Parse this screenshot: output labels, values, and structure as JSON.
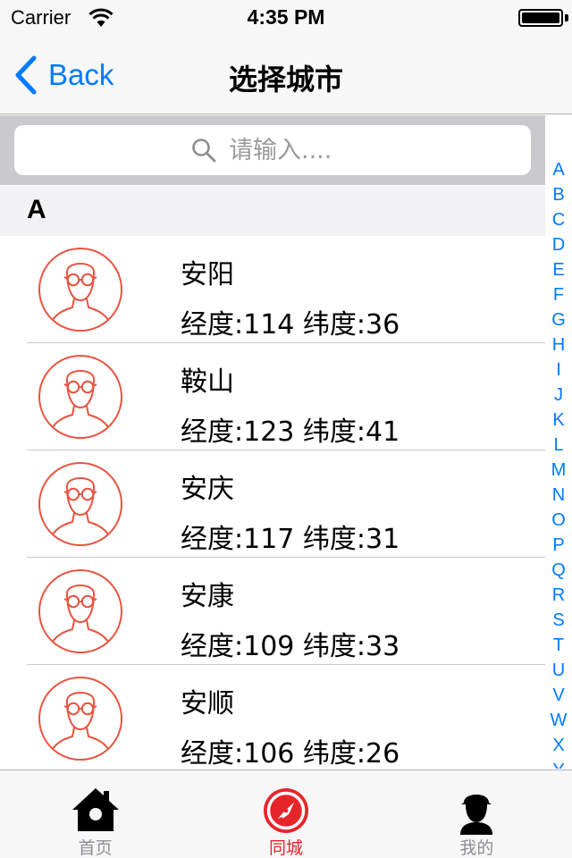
{
  "status_bar": {
    "carrier": "Carrier",
    "time": "4:35 PM"
  },
  "nav": {
    "back_label": "Back",
    "title": "选择城市"
  },
  "search": {
    "placeholder": "请输入...."
  },
  "section": {
    "letter": "A"
  },
  "cities": [
    {
      "name": "安阳",
      "coords": "经度:114 纬度:36"
    },
    {
      "name": "鞍山",
      "coords": "经度:123 纬度:41"
    },
    {
      "name": "安庆",
      "coords": "经度:117 纬度:31"
    },
    {
      "name": "安康",
      "coords": "经度:109 纬度:33"
    },
    {
      "name": "安顺",
      "coords": "经度:106 纬度:26"
    }
  ],
  "index_letters": [
    "A",
    "B",
    "C",
    "D",
    "E",
    "F",
    "G",
    "H",
    "I",
    "J",
    "K",
    "L",
    "M",
    "N",
    "O",
    "P",
    "Q",
    "R",
    "S",
    "T",
    "U",
    "V",
    "W",
    "X",
    "Y"
  ],
  "tabs": [
    {
      "label": "首页",
      "icon": "home-icon"
    },
    {
      "label": "同城",
      "icon": "compass-icon"
    },
    {
      "label": "我的",
      "icon": "profile-icon"
    }
  ],
  "colors": {
    "accent": "#007aff",
    "tab_active": "#e6252b",
    "avatar": "#e9533f"
  }
}
